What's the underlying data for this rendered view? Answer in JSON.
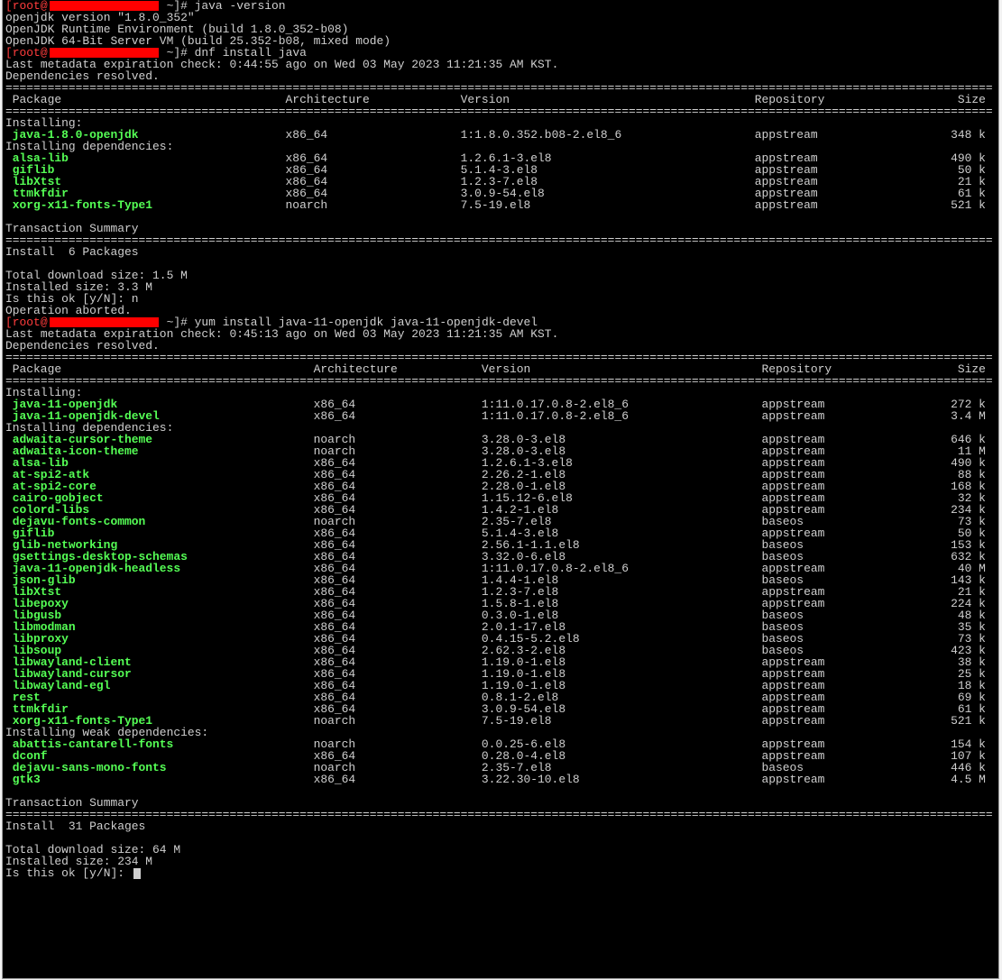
{
  "colors": {
    "background": "#000000",
    "text": "#cfcfcf",
    "package_name": "#55ff55",
    "prompt_user": "#ff3c3c",
    "redaction": "#ff0000",
    "cursor": "#cfcfcf"
  },
  "separator": "=============================================================================================================================================",
  "session": [
    {
      "type": "prompt",
      "prefix": "[root@",
      "suffix": " ~]# ",
      "command": "java -version"
    },
    {
      "type": "text",
      "text": "openjdk version \"1.8.0_352\""
    },
    {
      "type": "text",
      "text": "OpenJDK Runtime Environment (build 1.8.0_352-b08)"
    },
    {
      "type": "text",
      "text": "OpenJDK 64-Bit Server VM (build 25.352-b08, mixed mode)"
    },
    {
      "type": "prompt",
      "prefix": "[root@",
      "suffix": " ~]# ",
      "command": "dnf install java"
    },
    {
      "type": "text",
      "text": "Last metadata expiration check: 0:44:55 ago on Wed 03 May 2023 11:21:35 AM KST."
    },
    {
      "type": "text",
      "text": "Dependencies resolved."
    },
    {
      "type": "transaction",
      "header": {
        "package": "Package",
        "arch": "Architecture",
        "version": "Version",
        "repo": "Repository",
        "size": "Size"
      },
      "groups": [
        {
          "title": "Installing:",
          "packages": [
            {
              "name": "java-1.8.0-openjdk",
              "arch": "x86_64",
              "version": "1:1.8.0.352.b08-2.el8_6",
              "repo": "appstream",
              "size": "348 k"
            }
          ]
        },
        {
          "title": "Installing dependencies:",
          "packages": [
            {
              "name": "alsa-lib",
              "arch": "x86_64",
              "version": "1.2.6.1-3.el8",
              "repo": "appstream",
              "size": "490 k"
            },
            {
              "name": "giflib",
              "arch": "x86_64",
              "version": "5.1.4-3.el8",
              "repo": "appstream",
              "size": "50 k"
            },
            {
              "name": "libXtst",
              "arch": "x86_64",
              "version": "1.2.3-7.el8",
              "repo": "appstream",
              "size": "21 k"
            },
            {
              "name": "ttmkfdir",
              "arch": "x86_64",
              "version": "3.0.9-54.el8",
              "repo": "appstream",
              "size": "61 k"
            },
            {
              "name": "xorg-x11-fonts-Type1",
              "arch": "noarch",
              "version": "7.5-19.el8",
              "repo": "appstream",
              "size": "521 k"
            }
          ]
        }
      ],
      "summary_title": "Transaction Summary",
      "summary": "Install  6 Packages"
    },
    {
      "type": "blank"
    },
    {
      "type": "text",
      "text": "Total download size: 1.5 M"
    },
    {
      "type": "text",
      "text": "Installed size: 3.3 M"
    },
    {
      "type": "text",
      "text": "Is this ok [y/N]: n"
    },
    {
      "type": "text",
      "text": "Operation aborted."
    },
    {
      "type": "prompt",
      "prefix": "[root@",
      "suffix": " ~]# ",
      "command": "yum install java-11-openjdk java-11-openjdk-devel"
    },
    {
      "type": "text",
      "text": "Last metadata expiration check: 0:45:13 ago on Wed 03 May 2023 11:21:35 AM KST."
    },
    {
      "type": "text",
      "text": "Dependencies resolved."
    },
    {
      "type": "transaction",
      "header": {
        "package": "Package",
        "arch": "Architecture",
        "version": "Version",
        "repo": "Repository",
        "size": "Size"
      },
      "groups": [
        {
          "title": "Installing:",
          "packages": [
            {
              "name": "java-11-openjdk",
              "arch": "x86_64",
              "version": "1:11.0.17.0.8-2.el8_6",
              "repo": "appstream",
              "size": "272 k"
            },
            {
              "name": "java-11-openjdk-devel",
              "arch": "x86_64",
              "version": "1:11.0.17.0.8-2.el8_6",
              "repo": "appstream",
              "size": "3.4 M"
            }
          ]
        },
        {
          "title": "Installing dependencies:",
          "packages": [
            {
              "name": "adwaita-cursor-theme",
              "arch": "noarch",
              "version": "3.28.0-3.el8",
              "repo": "appstream",
              "size": "646 k"
            },
            {
              "name": "adwaita-icon-theme",
              "arch": "noarch",
              "version": "3.28.0-3.el8",
              "repo": "appstream",
              "size": "11 M"
            },
            {
              "name": "alsa-lib",
              "arch": "x86_64",
              "version": "1.2.6.1-3.el8",
              "repo": "appstream",
              "size": "490 k"
            },
            {
              "name": "at-spi2-atk",
              "arch": "x86_64",
              "version": "2.26.2-1.el8",
              "repo": "appstream",
              "size": "88 k"
            },
            {
              "name": "at-spi2-core",
              "arch": "x86_64",
              "version": "2.28.0-1.el8",
              "repo": "appstream",
              "size": "168 k"
            },
            {
              "name": "cairo-gobject",
              "arch": "x86_64",
              "version": "1.15.12-6.el8",
              "repo": "appstream",
              "size": "32 k"
            },
            {
              "name": "colord-libs",
              "arch": "x86_64",
              "version": "1.4.2-1.el8",
              "repo": "appstream",
              "size": "234 k"
            },
            {
              "name": "dejavu-fonts-common",
              "arch": "noarch",
              "version": "2.35-7.el8",
              "repo": "baseos",
              "size": "73 k"
            },
            {
              "name": "giflib",
              "arch": "x86_64",
              "version": "5.1.4-3.el8",
              "repo": "appstream",
              "size": "50 k"
            },
            {
              "name": "glib-networking",
              "arch": "x86_64",
              "version": "2.56.1-1.1.el8",
              "repo": "baseos",
              "size": "153 k"
            },
            {
              "name": "gsettings-desktop-schemas",
              "arch": "x86_64",
              "version": "3.32.0-6.el8",
              "repo": "baseos",
              "size": "632 k"
            },
            {
              "name": "java-11-openjdk-headless",
              "arch": "x86_64",
              "version": "1:11.0.17.0.8-2.el8_6",
              "repo": "appstream",
              "size": "40 M"
            },
            {
              "name": "json-glib",
              "arch": "x86_64",
              "version": "1.4.4-1.el8",
              "repo": "baseos",
              "size": "143 k"
            },
            {
              "name": "libXtst",
              "arch": "x86_64",
              "version": "1.2.3-7.el8",
              "repo": "appstream",
              "size": "21 k"
            },
            {
              "name": "libepoxy",
              "arch": "x86_64",
              "version": "1.5.8-1.el8",
              "repo": "appstream",
              "size": "224 k"
            },
            {
              "name": "libgusb",
              "arch": "x86_64",
              "version": "0.3.0-1.el8",
              "repo": "baseos",
              "size": "48 k"
            },
            {
              "name": "libmodman",
              "arch": "x86_64",
              "version": "2.0.1-17.el8",
              "repo": "baseos",
              "size": "35 k"
            },
            {
              "name": "libproxy",
              "arch": "x86_64",
              "version": "0.4.15-5.2.el8",
              "repo": "baseos",
              "size": "73 k"
            },
            {
              "name": "libsoup",
              "arch": "x86_64",
              "version": "2.62.3-2.el8",
              "repo": "baseos",
              "size": "423 k"
            },
            {
              "name": "libwayland-client",
              "arch": "x86_64",
              "version": "1.19.0-1.el8",
              "repo": "appstream",
              "size": "38 k"
            },
            {
              "name": "libwayland-cursor",
              "arch": "x86_64",
              "version": "1.19.0-1.el8",
              "repo": "appstream",
              "size": "25 k"
            },
            {
              "name": "libwayland-egl",
              "arch": "x86_64",
              "version": "1.19.0-1.el8",
              "repo": "appstream",
              "size": "18 k"
            },
            {
              "name": "rest",
              "arch": "x86_64",
              "version": "0.8.1-2.el8",
              "repo": "appstream",
              "size": "69 k"
            },
            {
              "name": "ttmkfdir",
              "arch": "x86_64",
              "version": "3.0.9-54.el8",
              "repo": "appstream",
              "size": "61 k"
            },
            {
              "name": "xorg-x11-fonts-Type1",
              "arch": "noarch",
              "version": "7.5-19.el8",
              "repo": "appstream",
              "size": "521 k"
            }
          ]
        },
        {
          "title": "Installing weak dependencies:",
          "packages": [
            {
              "name": "abattis-cantarell-fonts",
              "arch": "noarch",
              "version": "0.0.25-6.el8",
              "repo": "appstream",
              "size": "154 k"
            },
            {
              "name": "dconf",
              "arch": "x86_64",
              "version": "0.28.0-4.el8",
              "repo": "appstream",
              "size": "107 k"
            },
            {
              "name": "dejavu-sans-mono-fonts",
              "arch": "noarch",
              "version": "2.35-7.el8",
              "repo": "baseos",
              "size": "446 k"
            },
            {
              "name": "gtk3",
              "arch": "x86_64",
              "version": "3.22.30-10.el8",
              "repo": "appstream",
              "size": "4.5 M"
            }
          ]
        }
      ],
      "summary_title": "Transaction Summary",
      "summary": "Install  31 Packages"
    },
    {
      "type": "blank"
    },
    {
      "type": "text",
      "text": "Total download size: 64 M"
    },
    {
      "type": "text",
      "text": "Installed size: 234 M"
    },
    {
      "type": "input",
      "text": "Is this ok [y/N]: "
    }
  ]
}
